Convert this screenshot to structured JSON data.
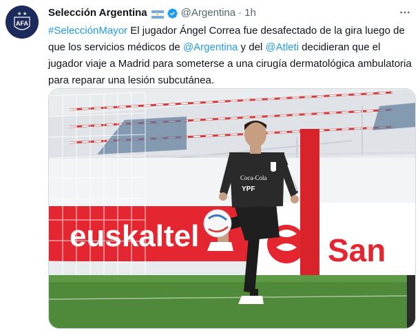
{
  "tweet": {
    "author_name": "Selección Argentina",
    "handle": "@Argentina",
    "separator": "·",
    "time": "1h",
    "avatar_text": "AFA",
    "text_segments": [
      {
        "text": "#SelecciónMayor",
        "link": true
      },
      {
        "text": " El jugador Ángel Correa fue desafectado de la gira luego de que los servicios médicos de ",
        "link": false
      },
      {
        "text": "@Argentina",
        "link": true
      },
      {
        "text": " y del ",
        "link": false
      },
      {
        "text": "@Atleti",
        "link": true
      },
      {
        "text": " decidieran que el jugador viaje a Madrid para someterse a una cirugía dermatológica ambulatoria para reparar una lesión subcutánea.",
        "link": false
      }
    ]
  },
  "photo": {
    "banner_left": "euskaltel",
    "banner_right": "San",
    "shirt_sponsor": "Coca-Cola",
    "shirt_sponsor2": "YPF"
  },
  "colors": {
    "link": "#1d9bf0",
    "secondary": "#536471",
    "verified": "#1d9bf0",
    "banner_red": "#e3262f",
    "grass": "#4f8a3a"
  },
  "icons": {
    "verified": "verified-badge-icon",
    "more": "more-options-icon",
    "flag": "argentina-flag-icon"
  }
}
